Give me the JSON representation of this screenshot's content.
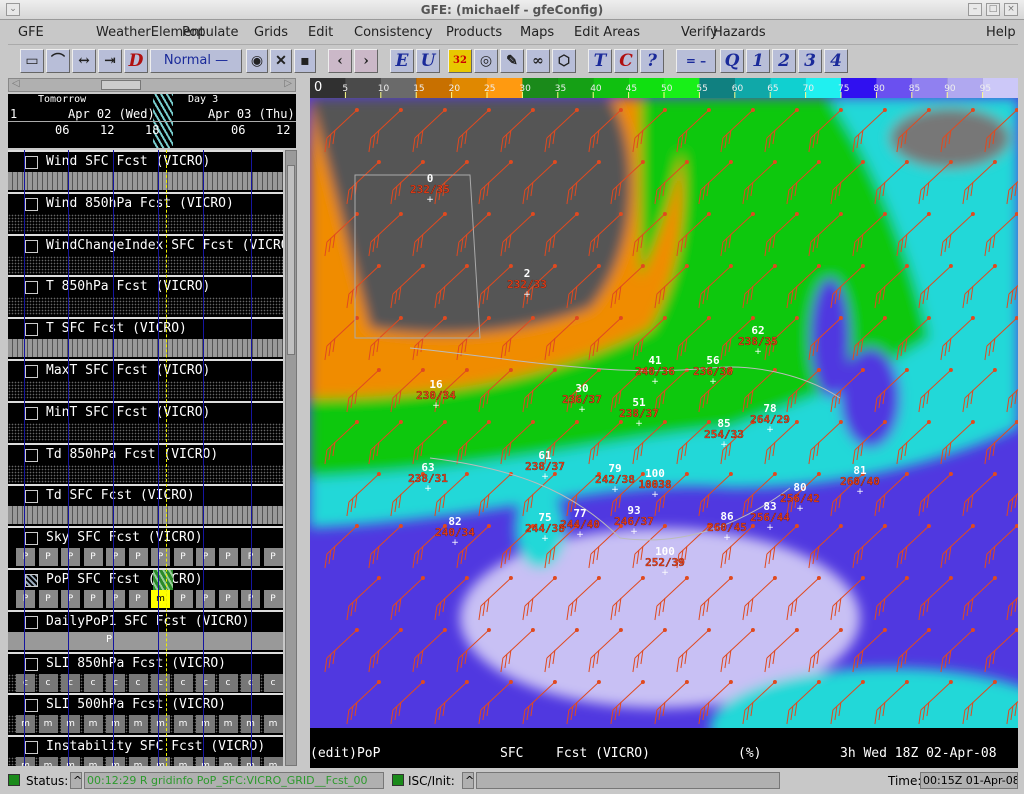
{
  "window": {
    "title": "GFE: (michaelf - gfeConfig)"
  },
  "menu": [
    "GFE",
    "WeatherElement",
    "Populate",
    "Grids",
    "Edit",
    "Consistency",
    "Products",
    "Maps",
    "Edit Areas",
    "Verify",
    "Hazards",
    "Help"
  ],
  "toolbar": {
    "mode_select": "Normal",
    "buttons": [
      {
        "icon": "grid-manager-icon"
      },
      {
        "icon": "curve-icon"
      },
      {
        "icon": "expand-time-icon"
      },
      {
        "icon": "contract-time-icon"
      },
      {
        "label": "D"
      },
      {
        "icon": "eye-icon"
      },
      {
        "icon": "map-edit-icon"
      },
      {
        "icon": "save-icon"
      },
      {
        "icon": "prev-icon"
      },
      {
        "icon": "next-icon"
      },
      {
        "label": "E"
      },
      {
        "label": "U"
      },
      {
        "label": "32"
      },
      {
        "icon": "target-icon"
      },
      {
        "icon": "pencil-icon"
      },
      {
        "icon": "link-icon"
      },
      {
        "icon": "shape-icon"
      },
      {
        "label": "T"
      },
      {
        "label": "C"
      },
      {
        "label": "?"
      },
      {
        "label": "= –"
      },
      {
        "label": "Q"
      },
      {
        "label": "1"
      },
      {
        "label": "2"
      },
      {
        "label": "3"
      },
      {
        "label": "4"
      }
    ]
  },
  "timeline": {
    "tomorrow": "Tomorrow",
    "day3": "Day 3",
    "date1": "Apr 02 (Wed)",
    "date2": "Apr 03 (Thu)",
    "lead": "1",
    "hours": [
      "06",
      "12",
      "18",
      "06",
      "12"
    ]
  },
  "grids": [
    {
      "label": "Wind SFC  Fcst (VICRO)",
      "fill": "p"
    },
    {
      "label": "Wind 850hPa  Fcst (VICRO)",
      "fill": "dots"
    },
    {
      "label": "WindChangeIndex SFC  Fcst (VICRO)",
      "fill": "dots"
    },
    {
      "label": "T 850hPa  Fcst (VICRO)",
      "fill": "dots"
    },
    {
      "label": "T SFC  Fcst (VICRO)",
      "fill": "p"
    },
    {
      "label": "MaxT SFC  Fcst (VICRO)",
      "fill": "box"
    },
    {
      "label": "MinT SFC  Fcst (VICRO)",
      "fill": "box"
    },
    {
      "label": "Td 850hPa  Fcst (VICRO)",
      "fill": "dots"
    },
    {
      "label": "Td SFC  Fcst (VICRO)",
      "fill": "p"
    },
    {
      "label": "Sky SFC  Fcst (VICRO)",
      "fill": "P"
    },
    {
      "label": "PoP SFC  Fcst (VICRO)",
      "fill": "P",
      "selected": true,
      "cell_letter": "m"
    },
    {
      "label": "DailyPoP1 SFC  Fcst (VICRO)",
      "fill": "single",
      "cell_letter": "P"
    },
    {
      "label": "SLI 850hPa  Fcst (VICRO)",
      "fill": "c"
    },
    {
      "label": "SLI 500hPa  Fcst (VICRO)",
      "fill": "m"
    },
    {
      "label": "Instability SFC  Fcst (VICRO)",
      "fill": "m"
    }
  ],
  "colorbar": {
    "ticks": [
      "0",
      "5",
      "10",
      "15",
      "20",
      "25",
      "30",
      "35",
      "40",
      "45",
      "50",
      "55",
      "60",
      "65",
      "70",
      "75",
      "80",
      "85",
      "90",
      "95"
    ],
    "colors": [
      "#303030",
      "#4a4a4a",
      "#6a6a6a",
      "#c87000",
      "#e08800",
      "#ff9a10",
      "#1a8a1a",
      "#15a015",
      "#10c010",
      "#10e010",
      "#18f018",
      "#108080",
      "#10a8a8",
      "#10d0d0",
      "#20f0f0",
      "#3010f0",
      "#6a50f0",
      "#9080f0",
      "#b0a8f0",
      "#ccc8f8"
    ]
  },
  "stations": [
    {
      "v": "0",
      "w": "232/35"
    },
    {
      "v": "2",
      "w": "232/33"
    },
    {
      "v": "62",
      "w": "238/35"
    },
    {
      "v": "41",
      "w": "240/36"
    },
    {
      "v": "56",
      "w": "236/36"
    },
    {
      "v": "16",
      "w": "230/34"
    },
    {
      "v": "30",
      "w": "236/37"
    },
    {
      "v": "51",
      "w": "238/37"
    },
    {
      "v": "78",
      "w": "264/29"
    },
    {
      "v": "85",
      "w": "254/33"
    },
    {
      "v": "61",
      "w": "238/37"
    },
    {
      "v": "63",
      "w": "238/31"
    },
    {
      "v": "79",
      "w": "242/38"
    },
    {
      "v": "100",
      "w": "10038"
    },
    {
      "v": "81",
      "w": "260/40"
    },
    {
      "v": "80",
      "w": "256/42"
    },
    {
      "v": "86",
      "w": "260/45"
    },
    {
      "v": "83",
      "w": "256/44"
    },
    {
      "v": "93",
      "w": "246/37"
    },
    {
      "v": "75",
      "w": "244/38"
    },
    {
      "v": "77",
      "w": "244/40"
    },
    {
      "v": "82",
      "w": "240/34"
    },
    {
      "v": "100",
      "w": "252/39"
    }
  ],
  "info": {
    "element": "(edit)PoP",
    "level": "SFC",
    "model": "Fcst (VICRO)",
    "units": "(%)",
    "time": "3h Wed 18Z 02-Apr-08"
  },
  "status": {
    "label": "Status:",
    "message": "00:12:29 R gridinfo PoP_SFC:VICRO_GRID__Fcst_00",
    "isc_label": "ISC/Init:",
    "isc_value": "",
    "time_label": "Time:",
    "time_value": "00:15Z 01-Apr-08"
  }
}
